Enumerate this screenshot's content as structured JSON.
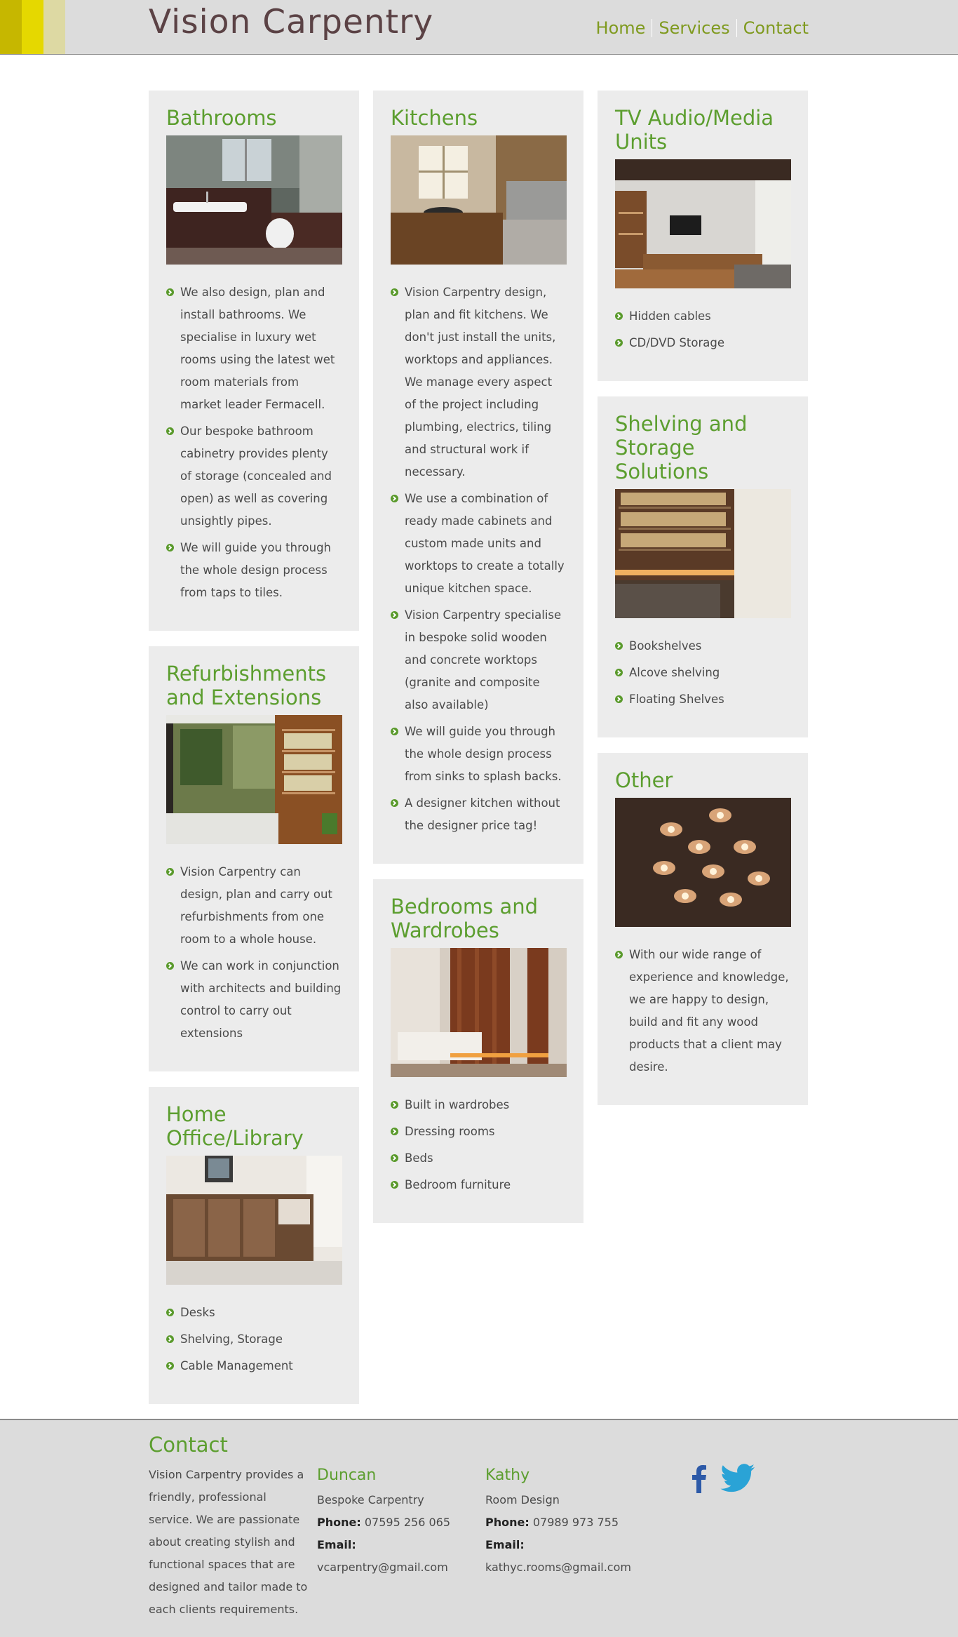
{
  "header": {
    "title": "Vision Carpentry",
    "nav": [
      "Home",
      "Services",
      "Contact"
    ]
  },
  "cards": {
    "bathrooms": {
      "title": "Bathrooms",
      "items": [
        "We also design, plan and install bathrooms. We specialise in luxury wet rooms using the latest wet room materials from market leader Fermacell.",
        "Our bespoke bathroom cabinetry provides plenty of storage (concealed and open) as well as covering unsightly pipes.",
        "We will guide you through the whole design process from taps to tiles."
      ]
    },
    "refurb": {
      "title": "Refurbishments and Extensions",
      "items": [
        "Vision Carpentry can design, plan and carry out refurbishments from one room to a whole house.",
        "We can work in conjunction with architects and building control to carry out extensions"
      ]
    },
    "office": {
      "title": "Home Office/Library",
      "items": [
        "Desks",
        "Shelving, Storage",
        "Cable Management"
      ]
    },
    "kitchens": {
      "title": "Kitchens",
      "items": [
        "Vision Carpentry design, plan and fit kitchens. We don't just install the units, worktops and appliances. We manage every aspect of the project including plumbing, electrics, tiling and structural work if necessary.",
        "We use a combination of ready made cabinets and custom made units and worktops to create a totally unique kitchen space.",
        "Vision Carpentry specialise in bespoke solid wooden and concrete worktops (granite and composite also available)",
        "We will guide you through the whole design process from sinks to splash backs.",
        "A designer kitchen without the designer price tag!"
      ]
    },
    "bedrooms": {
      "title": "Bedrooms and Wardrobes",
      "items": [
        "Built in wardrobes",
        "Dressing rooms",
        "Beds",
        "Bedroom furniture"
      ]
    },
    "tv": {
      "title": "TV Audio/Media Units",
      "items": [
        "Hidden cables",
        "CD/DVD Storage"
      ]
    },
    "shelving": {
      "title": "Shelving and Storage Solutions",
      "items": [
        "Bookshelves",
        "Alcove shelving",
        "Floating Shelves"
      ]
    },
    "other": {
      "title": "Other",
      "items": [
        "With our wide range of experience and knowledge, we are happy to design, build and fit any wood products that a client may desire."
      ]
    }
  },
  "footer": {
    "title": "Contact",
    "intro": "Vision Carpentry provides a friendly, professional service. We are passionate about creating stylish and functional spaces that are designed and tailor made to each clients requirements.",
    "duncan": {
      "name": "Duncan",
      "company": "Bespoke Carpentry",
      "phone_label": "Phone:",
      "phone": "07595 256 065",
      "email_label": "Email:",
      "email": "vcarpentry@gmail.com"
    },
    "kathy": {
      "name": "Kathy",
      "company": "Room Design",
      "phone_label": "Phone:",
      "phone": "07989 973 755",
      "email_label": "Email:",
      "email": "kathyc.rooms@gmail.com"
    },
    "social": [
      "facebook-icon",
      "twitter-icon"
    ],
    "colors": {
      "facebook": "#2d5aa8",
      "twitter": "#2aa3d6"
    }
  },
  "colors": {
    "accent_green": "#5c9e2f",
    "nav_green": "#7f9a1f",
    "title_brown": "#5b4245",
    "card_bg": "#ececec"
  }
}
